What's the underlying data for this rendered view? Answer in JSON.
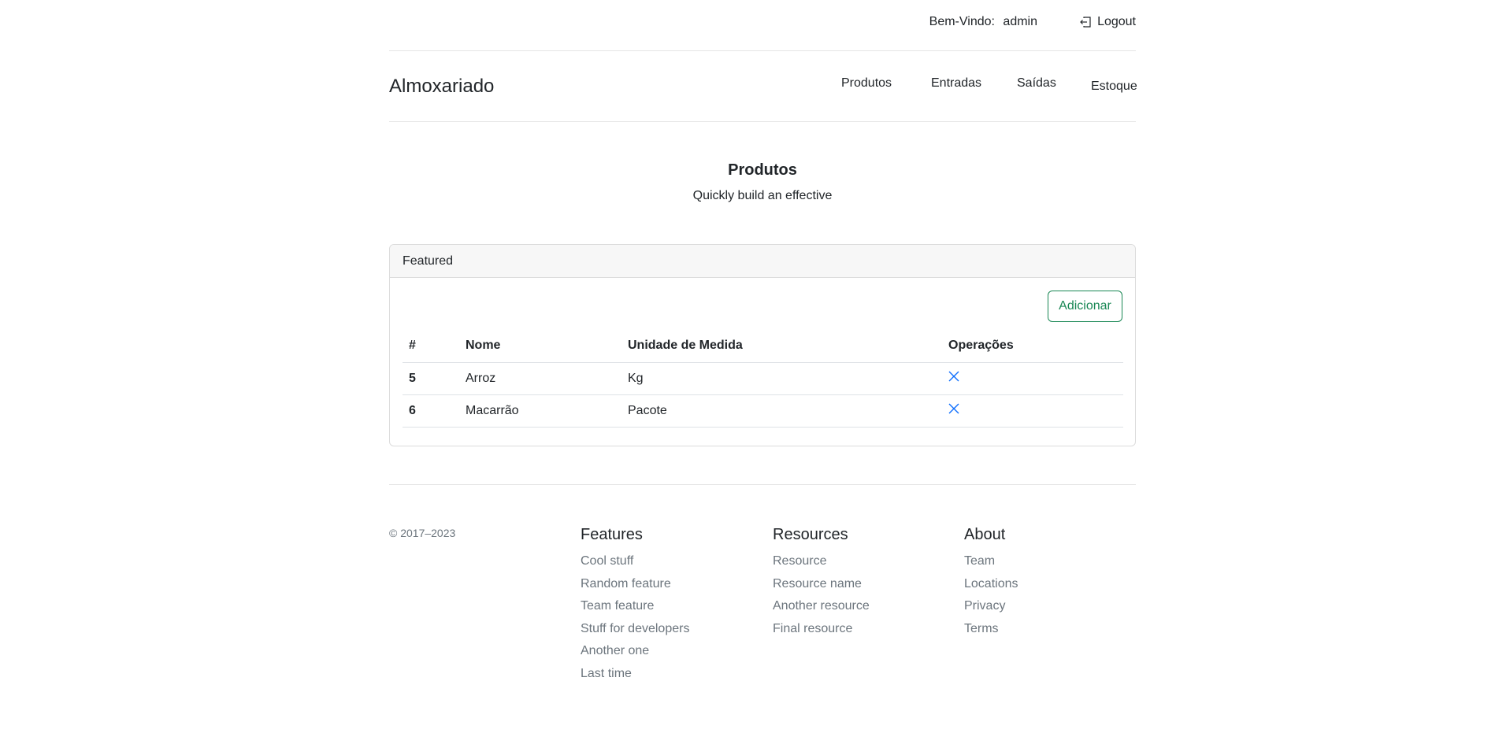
{
  "topbar": {
    "welcome_label": "Bem-Vindo:",
    "username": "admin",
    "logout_label": "Logout"
  },
  "navbar": {
    "brand": "Almoxariado",
    "items": [
      "Produtos",
      "Entradas",
      "Saídas",
      "Estoque"
    ]
  },
  "hero": {
    "title": "Produtos",
    "subtitle": "Quickly build an effective"
  },
  "card": {
    "header": "Featured",
    "add_button": "Adicionar",
    "columns": [
      "#",
      "Nome",
      "Unidade de Medida",
      "Operações"
    ],
    "rows": [
      {
        "id": "5",
        "nome": "Arroz",
        "unidade": "Kg"
      },
      {
        "id": "6",
        "nome": "Macarrão",
        "unidade": "Pacote"
      }
    ]
  },
  "footer": {
    "copyright": "© 2017–2023",
    "columns": [
      {
        "title": "Features",
        "links": [
          "Cool stuff",
          "Random feature",
          "Team feature",
          "Stuff for developers",
          "Another one",
          "Last time"
        ]
      },
      {
        "title": "Resources",
        "links": [
          "Resource",
          "Resource name",
          "Another resource",
          "Final resource"
        ]
      },
      {
        "title": "About",
        "links": [
          "Team",
          "Locations",
          "Privacy",
          "Terms"
        ]
      }
    ]
  },
  "colors": {
    "success": "#198754",
    "primary": "#0d6efd",
    "muted": "#6c757d"
  }
}
